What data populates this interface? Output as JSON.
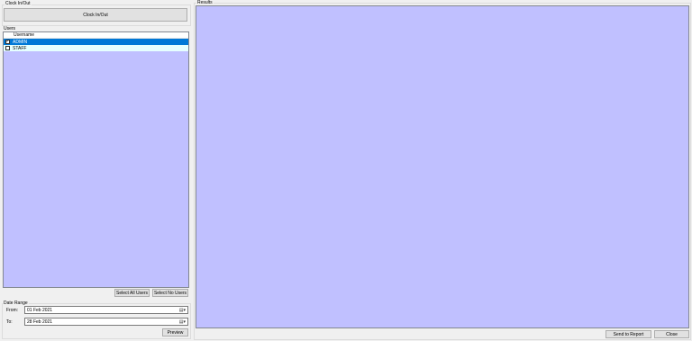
{
  "clock": {
    "group_label": "Clock In/Out",
    "button_label": "Clock In/Out"
  },
  "users": {
    "group_label": "Users",
    "column_header": "Username",
    "rows": [
      {
        "name": "ADMIN",
        "checked": true,
        "selected": true
      },
      {
        "name": "STAFF",
        "checked": false,
        "selected": false
      }
    ],
    "select_all_label": "Select All Users",
    "select_none_label": "Select No Users"
  },
  "date_range": {
    "group_label": "Date Range",
    "from_label": "From:",
    "from_value": "01 Feb 2021",
    "to_label": "To:",
    "to_value": "28 Feb 2021",
    "preview_label": "Preview"
  },
  "results": {
    "group_label": "Results",
    "send_to_report_label": "Send to Report",
    "close_label": "Close"
  },
  "colors": {
    "panel_bg": "#c0c0ff",
    "selected_row": "#0078d7",
    "unselected_row": "#e6ffff",
    "window_bg": "#f0f0f0"
  }
}
